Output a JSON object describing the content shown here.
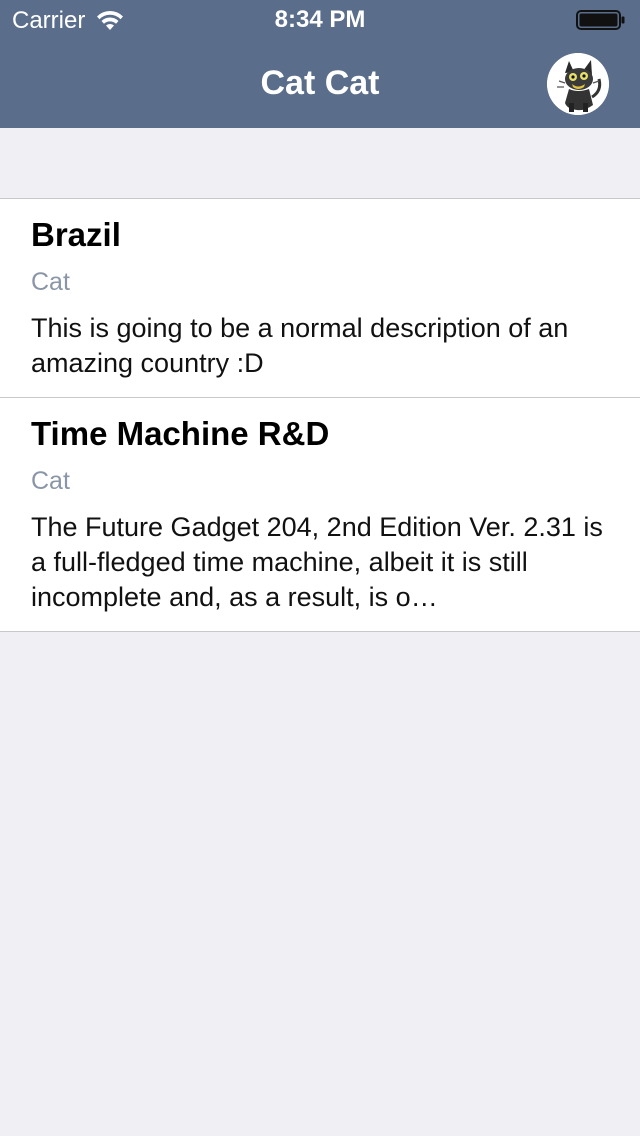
{
  "status_bar": {
    "carrier": "Carrier",
    "time": "8:34 PM"
  },
  "nav": {
    "title": "Cat Cat",
    "avatar_icon": "cat-avatar-icon"
  },
  "items": [
    {
      "title": "Brazil",
      "subtitle": "Cat",
      "description": "This is going to be a normal description of an amazing country :D"
    },
    {
      "title": "Time Machine R&D",
      "subtitle": "Cat",
      "description": "The Future Gadget 204, 2nd Edition Ver. 2.31 is a full-fledged time machine, albeit it is still incomplete and, as a result, is o…"
    }
  ],
  "colors": {
    "nav_bar": "#5a6d8a",
    "background": "#efeff4",
    "subtitle": "#8a96a8"
  }
}
